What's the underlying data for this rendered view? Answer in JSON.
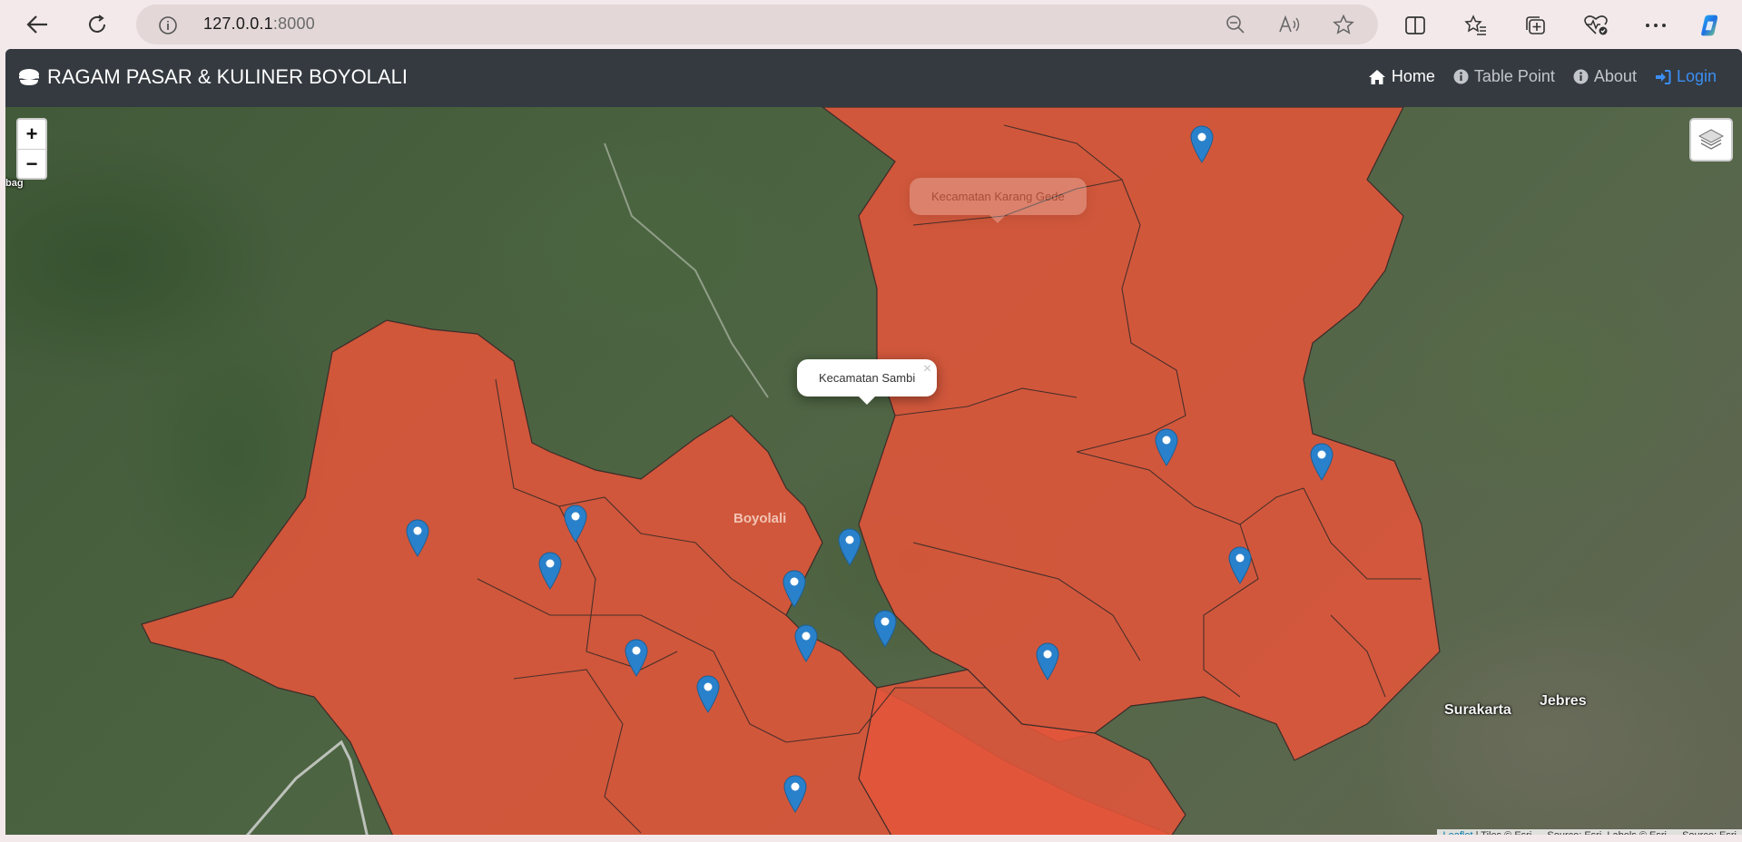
{
  "browser": {
    "url_host": "127.0.0.1",
    "url_port": ":8000"
  },
  "app": {
    "brand": "RAGAM PASAR & KULINER BOYOLALI",
    "nav": [
      {
        "label": "Home",
        "icon": "home-icon"
      },
      {
        "label": "Table Point",
        "icon": "info-circle-icon"
      },
      {
        "label": "About",
        "icon": "info-circle-icon"
      },
      {
        "label": "Login",
        "icon": "sign-in-icon"
      }
    ]
  },
  "map": {
    "zoom_in": "+",
    "zoom_out": "−",
    "popup_active": "Kecamatan Sambi",
    "popup_faded": "Kecamatan Karang Gede",
    "popup_close": "×",
    "labels": {
      "boyolali": "Boyolali",
      "surakarta": "Surakarta",
      "jebres": "Jebres",
      "edge_top_left": "bag"
    },
    "attribution": {
      "leaflet": "Leaflet",
      "rest": " | Tiles © Esri — Source: Esri, Labels © Esri — Source: Esri"
    },
    "region_color": "#e2553a",
    "marker_color": "#2a81cb"
  }
}
